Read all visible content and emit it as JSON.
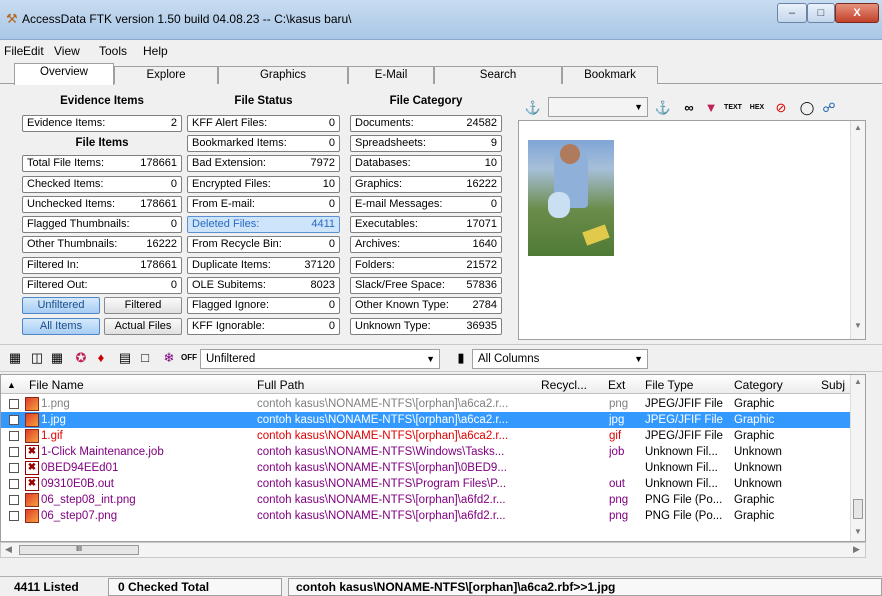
{
  "window": {
    "title": "AccessData FTK version 1.50 build 04.08.23 -- C:\\kasus baru\\",
    "minimize": "–",
    "maximize": "□",
    "close": "X"
  },
  "menu": [
    "File",
    "Edit",
    "View",
    "Tools",
    "Help"
  ],
  "tabs": [
    "Overview",
    "Explore",
    "Graphics",
    "E-Mail",
    "Search",
    "Bookmark"
  ],
  "evidence": {
    "heading": "Evidence Items",
    "evidence_items": {
      "label": "Evidence Items:",
      "value": "2"
    },
    "file_items_heading": "File Items",
    "total": {
      "label": "Total File Items:",
      "value": "178661"
    },
    "checked": {
      "label": "Checked Items:",
      "value": "0"
    },
    "unchecked": {
      "label": "Unchecked Items:",
      "value": "178661"
    },
    "flagged_thumb": {
      "label": "Flagged Thumbnails:",
      "value": "0"
    },
    "other_thumb": {
      "label": "Other Thumbnails:",
      "value": "16222"
    },
    "filtered_in": {
      "label": "Filtered In:",
      "value": "178661"
    },
    "filtered_out": {
      "label": "Filtered Out:",
      "value": "0"
    },
    "unfiltered_btn": "Unfiltered",
    "filtered_btn": "Filtered",
    "all_items_btn": "All Items",
    "actual_files_btn": "Actual Files"
  },
  "file_status": {
    "heading": "File Status",
    "kff_alert": {
      "label": "KFF Alert Files:",
      "value": "0"
    },
    "bookmarked": {
      "label": "Bookmarked Items:",
      "value": "0"
    },
    "bad_ext": {
      "label": "Bad Extension:",
      "value": "7972"
    },
    "encrypted": {
      "label": "Encrypted Files:",
      "value": "10"
    },
    "from_email": {
      "label": "From E-mail:",
      "value": "0"
    },
    "deleted": {
      "label": "Deleted Files:",
      "value": "4411"
    },
    "recycle": {
      "label": "From Recycle Bin:",
      "value": "0"
    },
    "duplicate": {
      "label": "Duplicate Items:",
      "value": "37120"
    },
    "ole": {
      "label": "OLE Subitems:",
      "value": "8023"
    },
    "flagged_ignore": {
      "label": "Flagged Ignore:",
      "value": "0"
    },
    "kff_ignorable": {
      "label": "KFF Ignorable:",
      "value": "0"
    }
  },
  "file_category": {
    "heading": "File Category",
    "documents": {
      "label": "Documents:",
      "value": "24582"
    },
    "spreadsheets": {
      "label": "Spreadsheets:",
      "value": "9"
    },
    "databases": {
      "label": "Databases:",
      "value": "10"
    },
    "graphics": {
      "label": "Graphics:",
      "value": "16222"
    },
    "email": {
      "label": "E-mail Messages:",
      "value": "0"
    },
    "executables": {
      "label": "Executables:",
      "value": "17071"
    },
    "archives": {
      "label": "Archives:",
      "value": "1640"
    },
    "folders": {
      "label": "Folders:",
      "value": "21572"
    },
    "slack": {
      "label": "Slack/Free Space:",
      "value": "57836"
    },
    "other_known": {
      "label": "Other Known Type:",
      "value": "2784"
    },
    "unknown": {
      "label": "Unknown Type:",
      "value": "36935"
    }
  },
  "viewer_toolbar": {
    "icons": [
      "find-icon",
      "combo",
      "find-next-icon",
      "glasses-icon",
      "filter-icon",
      "text-view-icon",
      "hex-view-icon",
      "no-glasses-icon",
      "copy-icon",
      "web-icon"
    ],
    "text_label": "TEXT",
    "hex_label": "HEX"
  },
  "list_toolbar": {
    "off_label": "OFF",
    "filter_combo": "Unfiltered",
    "columns_combo": "All Columns"
  },
  "grid": {
    "columns": [
      "File Name",
      "Full Path",
      "Recycl...",
      "Ext",
      "File Type",
      "Category",
      "Subj"
    ],
    "rows": [
      {
        "name": "1.png",
        "path": "contoh kasus\\NONAME-NTFS\\[orphan]\\a6ca2.r...",
        "ext": "png",
        "type": "JPEG/JFIF File",
        "category": "Graphic",
        "color": "#808080",
        "icon": "image",
        "selected": false
      },
      {
        "name": "1.jpg",
        "path": "contoh kasus\\NONAME-NTFS\\[orphan]\\a6ca2.r...",
        "ext": "jpg",
        "type": "JPEG/JFIF File",
        "category": "Graphic",
        "color": "#ffffff",
        "icon": "image",
        "selected": true
      },
      {
        "name": "1.gif",
        "path": "contoh kasus\\NONAME-NTFS\\[orphan]\\a6ca2.r...",
        "ext": "gif",
        "type": "JPEG/JFIF File",
        "category": "Graphic",
        "color": "#e00000",
        "icon": "image",
        "selected": false
      },
      {
        "name": "1-Click Maintenance.job",
        "path": "contoh kasus\\NONAME-NTFS\\Windows\\Tasks...",
        "ext": "job",
        "type": "Unknown Fil...",
        "category": "Unknown",
        "color": "#800080",
        "icon": "job",
        "selected": false
      },
      {
        "name": "0BED94EEd01",
        "path": "contoh kasus\\NONAME-NTFS\\[orphan]\\0BED9...",
        "ext": "",
        "type": "Unknown Fil...",
        "category": "Unknown",
        "color": "#800080",
        "icon": "job",
        "selected": false
      },
      {
        "name": "09310E0B.out",
        "path": "contoh kasus\\NONAME-NTFS\\Program Files\\P...",
        "ext": "out",
        "type": "Unknown Fil...",
        "category": "Unknown",
        "color": "#800080",
        "icon": "job",
        "selected": false
      },
      {
        "name": "06_step08_int.png",
        "path": "contoh kasus\\NONAME-NTFS\\[orphan]\\a6fd2.r...",
        "ext": "png",
        "type": "PNG File (Po...",
        "category": "Graphic",
        "color": "#800080",
        "icon": "image",
        "selected": false
      },
      {
        "name": "06_step07.png",
        "path": "contoh kasus\\NONAME-NTFS\\[orphan]\\a6fd2.r...",
        "ext": "png",
        "type": "PNG File (Po...",
        "category": "Graphic",
        "color": "#800080",
        "icon": "image",
        "selected": false
      }
    ],
    "hscroll_thumb": "III"
  },
  "status": {
    "listed": "4411 Listed",
    "checked_total": "0 Checked Total",
    "path": "contoh kasus\\NONAME-NTFS\\[orphan]\\a6ca2.rbf>>1.jpg"
  }
}
